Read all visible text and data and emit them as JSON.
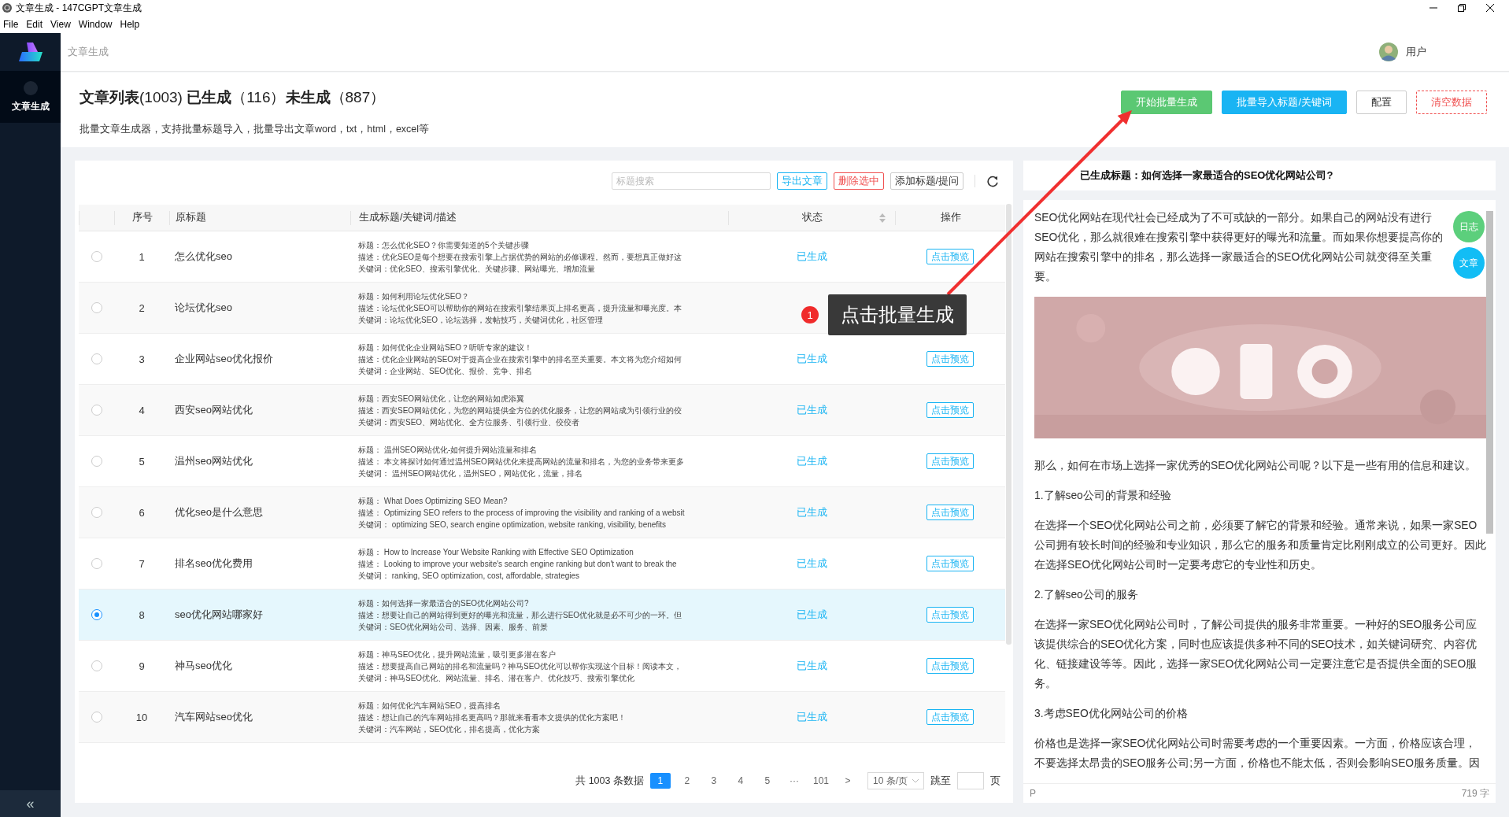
{
  "window": {
    "title": "文章生成 - 147CGPT文章生成"
  },
  "menu": [
    "File",
    "Edit",
    "View",
    "Window",
    "Help"
  ],
  "sidebar": {
    "items": [
      {
        "label": "文章生成",
        "selected": true
      }
    ],
    "collapse": "«"
  },
  "header": {
    "breadcrumb": "文章生成",
    "user": "用户"
  },
  "heading": {
    "title": "**文章列表**(1003) **已生成**（116）**未生成**（887）",
    "subtitle": "批量文章生成器，支持批量标题导入，批量导出文章word，txt，html，excel等",
    "actions": [
      {
        "label": "开始批量生成",
        "kind": "success"
      },
      {
        "label": "批量导入标题/关键词",
        "kind": "primary"
      },
      {
        "label": "配置",
        "kind": "default"
      },
      {
        "label": "清空数据",
        "kind": "danger"
      }
    ]
  },
  "toolbar": {
    "search": {
      "placeholder": "标题搜索"
    },
    "buttons": [
      {
        "label": "导出文章",
        "kind": "primary"
      },
      {
        "label": "删除选中",
        "kind": "danger"
      },
      {
        "label": "添加标题/提问",
        "kind": "default"
      }
    ]
  },
  "table": {
    "columns": [
      "序号",
      "原标题",
      "生成标题/关键词/描述",
      "状态",
      "操作"
    ],
    "rows": [
      {
        "selected": false,
        "index": "1",
        "original": "怎么优化seo",
        "lines": [
          "标题：怎么优化SEO？你需要知道的5个关键步骤",
          "描述：优化SEO是每个想要在搜索引擎上占据优势的网站的必修课程。然而，要想真正做好这",
          "关键词：优化SEO、搜索引擎优化、关键步骤、网站曝光、增加流量"
        ],
        "status": "已生成",
        "action": "点击预览"
      },
      {
        "selected": false,
        "index": "2",
        "original": "论坛优化seo",
        "lines": [
          "标题：如何利用论坛优化SEO？",
          "描述：论坛优化SEO可以帮助你的网站在搜索引擎结果页上排名更高，提升流量和曝光度。本",
          "关键词：论坛优化SEO，论坛选择，发帖技巧，关键词优化，社区管理"
        ]
      },
      {
        "selected": false,
        "index": "3",
        "original": "企业网站seo优化报价",
        "lines": [
          "标题：如何优化企业网站SEO？听听专家的建议！",
          "描述：优化企业网站的SEO对于提高企业在搜索引擎中的排名至关重要。本文将为您介绍如何",
          "关键词：企业网站、SEO优化、报价、竞争、排名"
        ],
        "status": "已生成",
        "action": "点击预览"
      },
      {
        "selected": false,
        "index": "4",
        "original": "西安seo网站优化",
        "lines": [
          "标题：西安SEO网站优化，让您的网站如虎添翼",
          "描述：西安SEO网站优化，为您的网站提供全方位的优化服务，让您的网站成为引领行业的佼",
          "关键词：西安SEO、网站优化、全方位服务、引领行业、佼佼者"
        ],
        "status": "已生成",
        "action": "点击预览"
      },
      {
        "selected": false,
        "index": "5",
        "original": "温州seo网站优化",
        "lines": [
          "标题： 温州SEO网站优化-如何提升网站流量和排名",
          "描述： 本文将探讨如何通过温州SEO网站优化来提高网站的流量和排名，为您的业务带来更多",
          "关键词： 温州SEO网站优化，温州SEO，网站优化，流量，排名"
        ],
        "status": "已生成",
        "action": "点击预览"
      },
      {
        "selected": false,
        "index": "6",
        "original": "优化seo是什么意思",
        "lines": [
          "标题： What Does Optimizing SEO Mean?",
          "描述： Optimizing SEO refers to the process of improving the visibility and ranking of a websit",
          "关键词： optimizing SEO, search engine optimization, website ranking, visibility, benefits"
        ],
        "status": "已生成",
        "action": "点击预览"
      },
      {
        "selected": false,
        "index": "7",
        "original": "排名seo优化费用",
        "lines": [
          "标题： How to Increase Your Website Ranking with Effective SEO Optimization",
          "描述： Looking to improve your website's search engine ranking but don't want to break the",
          "关键词： ranking, SEO optimization, cost, affordable, strategies"
        ],
        "status": "已生成",
        "action": "点击预览"
      },
      {
        "selected": true,
        "index": "8",
        "original": "seo优化网站哪家好",
        "lines": [
          "标题：如何选择一家最适合的SEO优化网站公司?",
          "描述：想要让自己的网站得到更好的曝光和流量，那么进行SEO优化就是必不可少的一环。但",
          "关键词：SEO优化网站公司、选择、因素、服务、前景"
        ],
        "status": "已生成",
        "action": "点击预览"
      },
      {
        "selected": false,
        "index": "9",
        "original": "神马seo优化",
        "lines": [
          "标题：神马SEO优化，提升网站流量，吸引更多潜在客户",
          "描述：想要提高自己网站的排名和流量吗？神马SEO优化可以帮你实现这个目标！阅读本文，",
          "关键词：神马SEO优化、网站流量、排名、潜在客户、优化技巧、搜索引擎优化"
        ],
        "status": "已生成",
        "action": "点击预览"
      },
      {
        "selected": false,
        "index": "10",
        "original": "汽车网站seo优化",
        "lines": [
          "标题：如何优化汽车网站SEO，提高排名",
          "描述：想让自己的汽车网站排名更高吗？那就来看看本文提供的优化方案吧！",
          "关键词：汽车网站，SEO优化，排名提高，优化方案"
        ],
        "status": "已生成",
        "action": "点击预览"
      }
    ]
  },
  "pagination": {
    "total": "共 1003 条数据",
    "pages": [
      {
        "label": "1",
        "selected": true
      },
      {
        "label": "2",
        "selected": false
      },
      {
        "label": "3",
        "selected": false
      },
      {
        "label": "4",
        "selected": false
      },
      {
        "label": "5",
        "selected": false
      },
      {
        "label": "···",
        "selected": false
      },
      {
        "label": "101",
        "selected": false
      }
    ],
    "next": ">",
    "page_size": "10 条/页",
    "jump_label": "跳至",
    "jump_suffix": "页"
  },
  "preview": {
    "title": "已生成标题：如何选择一家最适合的SEO优化网站公司?",
    "float_buttons": [
      {
        "label": "日志",
        "color": "#5ccf7c"
      },
      {
        "label": "文章",
        "color": "#12bdf5"
      }
    ],
    "blocks": [
      {
        "kind": "text",
        "text": "SEO优化网站在现代社会已经成为了不可或缺的一部分。如果自己的网站没有进行SEO优化，那么就很难在搜索引擎中获得更好的曝光和流量。而如果你想要提高你的网站在搜索引擎中的排名，那么选择一家最适合的SEO优化网站公司就变得至关重要。"
      },
      {
        "kind": "picture"
      },
      {
        "kind": "text",
        "text": "那么，如何在市场上选择一家优秀的SEO优化网站公司呢？以下是一些有用的信息和建议。"
      },
      {
        "kind": "text",
        "text": "1.了解seo公司的背景和经验"
      },
      {
        "kind": "text",
        "text": "在选择一个SEO优化网站公司之前，必须要了解它的背景和经验。通常来说，如果一家SEO公司拥有较长时间的经验和专业知识，那么它的服务和质量肯定比刚刚成立的公司更好。因此在选择SEO优化网站公司时一定要考虑它的专业性和历史。"
      },
      {
        "kind": "text",
        "text": "2.了解seo公司的服务"
      },
      {
        "kind": "text",
        "text": "在选择一家SEO优化网站公司时，了解公司提供的服务非常重要。一种好的SEO服务公司应该提供综合的SEO优化方案，同时也应该提供多种不同的SEO技术，如关键词研究、内容优化、链接建设等等。因此，选择一家SEO优化网站公司一定要注意它是否提供全面的SEO服务。"
      },
      {
        "kind": "text",
        "text": "3.考虑SEO优化网站公司的价格"
      },
      {
        "kind": "text",
        "text": "价格也是选择一家SEO优化网站公司时需要考虑的一个重要因素。一方面，价格应该合理，不要选择太昂贵的SEO服务公司;另一方面，价格也不能太低，否则会影响SEO服务质量。因"
      }
    ],
    "path": "P",
    "word_count": "719 字"
  },
  "annotation": {
    "badge": "1",
    "text": "点击批量生成"
  }
}
